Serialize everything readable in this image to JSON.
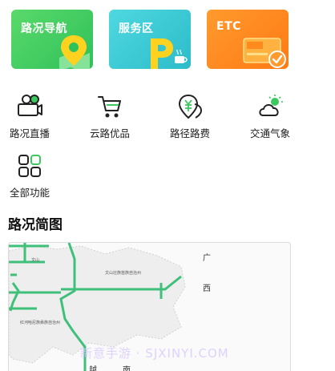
{
  "cards": [
    {
      "label": "路况导航",
      "icon": "map-pin-icon",
      "color": "#3cc85e"
    },
    {
      "label": "服务区",
      "icon": "parking-icon",
      "color": "#35c6d2"
    },
    {
      "label": "ETC",
      "icon": "etc-card-icon",
      "color": "#ff8a20"
    }
  ],
  "services": [
    {
      "label": "路况直播",
      "icon": "camera-icon"
    },
    {
      "label": "云路优品",
      "icon": "cart-icon"
    },
    {
      "label": "路径路费",
      "icon": "yuan-pin-icon"
    },
    {
      "label": "交通气象",
      "icon": "weather-icon"
    },
    {
      "label": "全部功能",
      "icon": "grid-icon"
    }
  ],
  "map_section": {
    "title": "路况简图",
    "region_labels": [
      "广",
      "西",
      "越",
      "南"
    ],
    "place_labels": [
      "文山壮族苗族自治州",
      "红河哈尼族彝族自治州",
      "文山"
    ]
  },
  "watermark": "新意手游 · SJXINYI.COM",
  "colors": {
    "road": "#3fc07a",
    "accent_green": "#2fbf5b"
  }
}
